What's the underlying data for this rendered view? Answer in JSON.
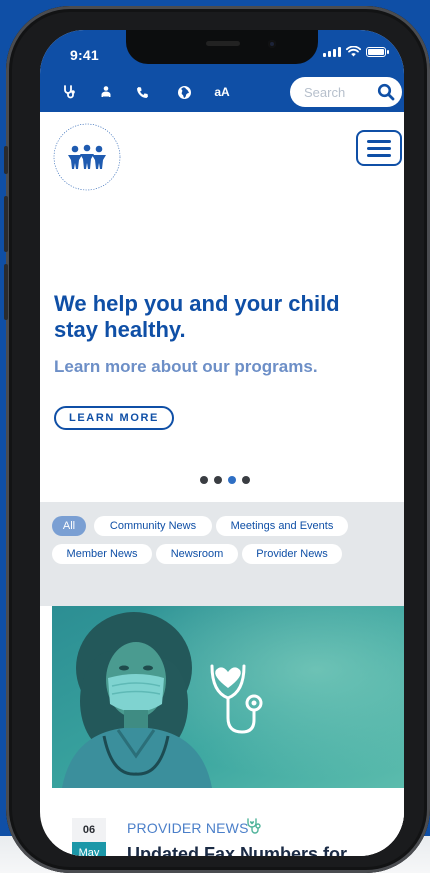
{
  "status_bar": {
    "time": "9:41"
  },
  "toolbar": {
    "icons": [
      "stethoscope-icon",
      "people-icon",
      "phone-icon",
      "globe-icon"
    ],
    "text_size_label": "aA",
    "search_placeholder": "Search"
  },
  "hero": {
    "title": "We help you and your child stay healthy.",
    "subtitle": "Learn more about our programs.",
    "cta_label": "LEARN MORE",
    "slides": 4,
    "active_slide": 3
  },
  "filters": {
    "chips": [
      {
        "label": "All",
        "active": true
      },
      {
        "label": "Community News",
        "active": false
      },
      {
        "label": "Meetings and Events",
        "active": false
      },
      {
        "label": "Member News",
        "active": false
      },
      {
        "label": "Newsroom",
        "active": false
      },
      {
        "label": "Provider News",
        "active": false
      }
    ]
  },
  "news": {
    "day": "06",
    "month": "May",
    "category": "PROVIDER NEWS",
    "title": "Updated Fax Numbers for"
  },
  "colors": {
    "brand_blue": "#0f4fa6",
    "subtitle_blue": "#6d8fc7",
    "teal": "#1b97a8",
    "filter_bg": "#e4e7ea"
  }
}
